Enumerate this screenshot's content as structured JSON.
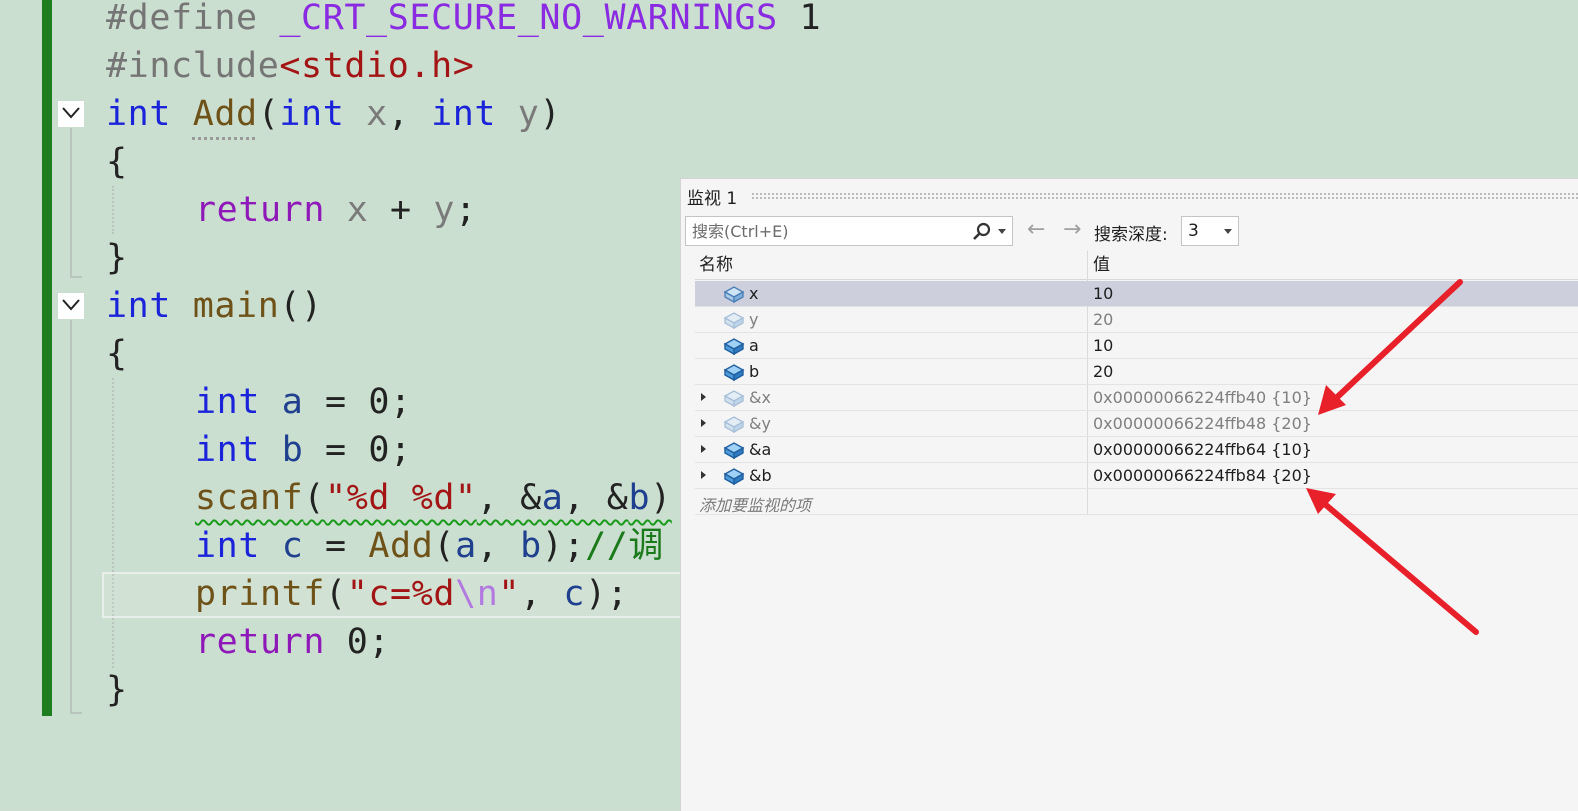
{
  "editor": {
    "lines": {
      "l1": [
        "#define ",
        "_CRT_SECURE_NO_WARNINGS",
        " 1"
      ],
      "l2": [
        "#include",
        "<stdio.h>"
      ],
      "l3": [
        "int",
        " ",
        "Add",
        "(",
        "int",
        " ",
        "x",
        ", ",
        "int",
        " ",
        "y",
        ")"
      ],
      "l4": "{",
      "l5": [
        "return",
        " ",
        "x",
        " + ",
        "y",
        ";"
      ],
      "l6": "}",
      "l7": [
        "int",
        " ",
        "main",
        "()"
      ],
      "l8": "{",
      "l9": [
        "int",
        " ",
        "a",
        " = 0;"
      ],
      "l10": [
        "int",
        " ",
        "b",
        " = 0;"
      ],
      "l11": [
        "scanf",
        "(",
        "\"%d %d\"",
        ", &",
        "a",
        ", &",
        "b",
        ")"
      ],
      "l12": [
        "int",
        " ",
        "c",
        " = ",
        "Add",
        "(",
        "a",
        ", ",
        "b",
        ");",
        "//调"
      ],
      "l13": [
        "printf",
        "(",
        "\"c=%d",
        "\\n",
        "\"",
        ", ",
        "c",
        ");"
      ],
      "l14": [
        "return",
        " 0;"
      ],
      "l15": "}"
    }
  },
  "watch": {
    "title": "监视 1",
    "search_placeholder": "搜索(Ctrl+E)",
    "back_arrow": "←",
    "forward_arrow": "→",
    "depth_label": "搜索深度:",
    "depth_value": "3",
    "col_name": "名称",
    "col_value": "值",
    "rows": [
      {
        "name": "x",
        "value": "10"
      },
      {
        "name": "y",
        "value": "20"
      },
      {
        "name": "a",
        "value": "10"
      },
      {
        "name": "b",
        "value": "20"
      },
      {
        "name": "&x",
        "value": "0x00000066224ffb40 {10}"
      },
      {
        "name": "&y",
        "value": "0x00000066224ffb48 {20}"
      },
      {
        "name": "&a",
        "value": "0x00000066224ffb64 {10}"
      },
      {
        "name": "&b",
        "value": "0x00000066224ffb84 {20}"
      }
    ],
    "add_item": "添加要监视的项"
  },
  "colors": {
    "editor_bg": "#cbdfd0",
    "change_bar": "#1e7d1e",
    "keyword": "#1a23d9",
    "annotation_arrow": "#e8202a",
    "selected_row": "#cdd0dc"
  }
}
